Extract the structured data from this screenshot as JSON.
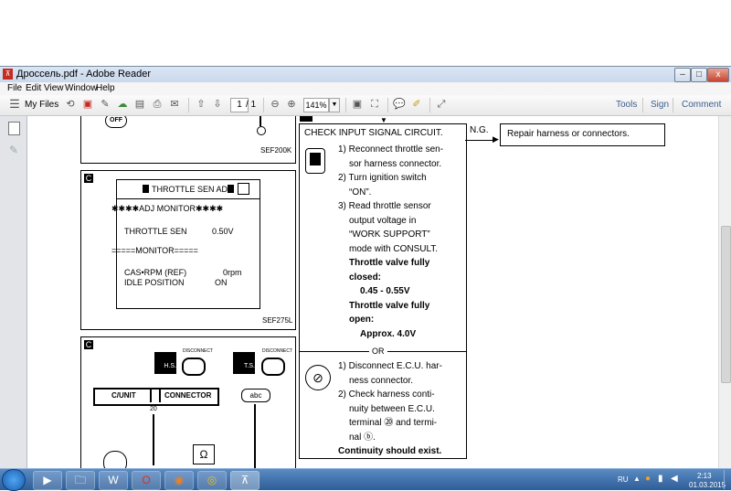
{
  "window": {
    "title": "Дроссель.pdf - Adobe Reader",
    "app_icon": "pdf-icon",
    "controls": {
      "minimize": "–",
      "maximize": "□",
      "close": "x"
    }
  },
  "menu": [
    "File",
    "Edit",
    "View",
    "Window",
    "Help"
  ],
  "toolbar": {
    "my_files": "My Files",
    "page_current": "1",
    "page_total": "/ 1",
    "zoom": "141%",
    "tools": "Tools",
    "sign": "Sign",
    "comment": "Comment"
  },
  "document": {
    "top_box": {
      "label": "SEF200K",
      "badge": "OFF"
    },
    "monitor_box": {
      "badge": "C",
      "header": "THROTTLE SEN ADJ",
      "adj_monitor": "✱✱✱✱ADJ MONITOR✱✱✱✱",
      "throttle_sen_label": "THROTTLE SEN",
      "throttle_sen_value": "0.50V",
      "monitor_line": "=====MONITOR=====",
      "cas_rpm_label": "CAS•RPM (REF)",
      "cas_rpm_value": "0rpm",
      "idle_label": "IDLE POSITION",
      "idle_value": "ON",
      "fig_label": "SEF275L"
    },
    "connector_box": {
      "badge": "C",
      "h_s": "H.S.",
      "t_s": "T.S.",
      "disconnect": "DISCONNECT",
      "c_unit": "C/UNIT",
      "connector": "CONNECTOR",
      "pin": "20",
      "abc": "abc",
      "ohm": "Ω"
    },
    "check_box": {
      "title": "CHECK INPUT SIGNAL CIRCUIT.",
      "steps_a": [
        "1) Reconnect throttle sen-",
        "sor harness connector.",
        "2) Turn ignition switch",
        "“ON”.",
        "3) Read throttle sensor",
        "output voltage in",
        "“WORK SUPPORT”",
        "mode with CONSULT."
      ],
      "valve_closed": "Throttle valve fully",
      "valve_closed_2": "closed:",
      "closed_value": "0.45 - 0.55V",
      "valve_open": "Throttle valve fully",
      "valve_open_2": "open:",
      "open_value": "Approx. 4.0V",
      "or": "OR",
      "steps_b": [
        "1) Disconnect E.C.U. har-",
        "ness connector.",
        "2) Check harness conti-",
        "nuity between E.C.U.",
        "terminal ⑳ and termi-",
        "nal ⓑ."
      ],
      "continuity": "Continuity should exist."
    },
    "ng_label": "N.G.",
    "repair_box": "Repair harness or connectors."
  },
  "taskbar": {
    "lang": "RU",
    "time": "2:13",
    "date": "01.03.2015"
  }
}
